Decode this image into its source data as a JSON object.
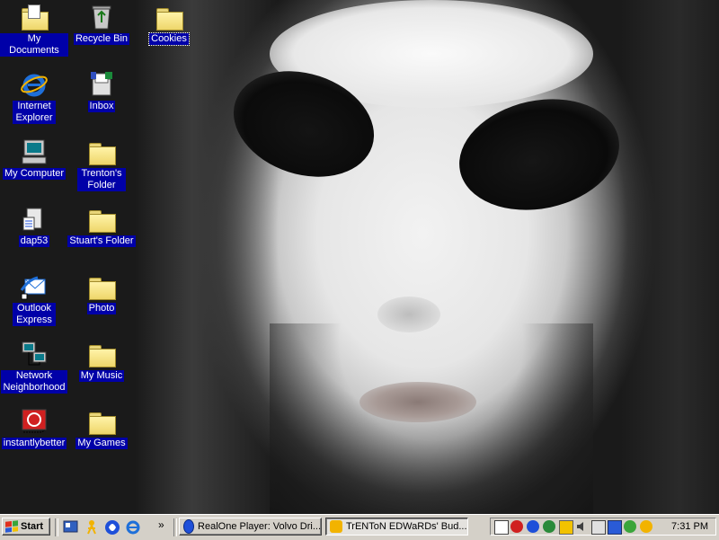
{
  "desktop": {
    "icons": [
      {
        "label": "My Documents",
        "icon": "my-documents-icon"
      },
      {
        "label": "Recycle Bin",
        "icon": "recycle-bin-icon"
      },
      {
        "label": "Cookies",
        "icon": "folder-icon"
      },
      {
        "label": "Internet Explorer",
        "icon": "internet-explorer-icon"
      },
      {
        "label": "Inbox",
        "icon": "inbox-icon"
      },
      {
        "label": "My Computer",
        "icon": "my-computer-icon"
      },
      {
        "label": "Trenton's Folder",
        "icon": "folder-icon"
      },
      {
        "label": "dap53",
        "icon": "dap-icon"
      },
      {
        "label": "Stuart's Folder",
        "icon": "folder-icon"
      },
      {
        "label": "Outlook Express",
        "icon": "outlook-express-icon"
      },
      {
        "label": "Photo",
        "icon": "folder-icon"
      },
      {
        "label": "Network Neighborhood",
        "icon": "network-neighborhood-icon"
      },
      {
        "label": "My Music",
        "icon": "folder-icon"
      },
      {
        "label": "instantlybetter",
        "icon": "instantlybetter-icon"
      },
      {
        "label": "My Games",
        "icon": "folder-icon"
      }
    ],
    "wallpaper": "alien face wallpaper"
  },
  "taskbar": {
    "start_label": "Start",
    "quick_launch": [
      "show-desktop-icon",
      "aim-icon",
      "realone-icon",
      "internet-explorer-icon"
    ],
    "chevron": "»",
    "tasks": [
      {
        "label": "RealOne Player: Volvo Dri...",
        "icon": "realone-icon",
        "active": false
      },
      {
        "label": "TrENToN EDWaRDs' Bud...",
        "icon": "aim-icon",
        "active": true
      }
    ],
    "tray_icons": [
      "network-icon",
      "security-icon",
      "realone-tray-icon",
      "globe-icon",
      "display-icon",
      "volume-icon",
      "mail-icon",
      "task-scheduler-icon",
      "messenger-icon",
      "aim-tray-icon"
    ],
    "clock": "7:31 PM"
  },
  "colors": {
    "selection": "#0000a8",
    "taskbar": "#d4d0c8",
    "folder": "#eed66a"
  }
}
